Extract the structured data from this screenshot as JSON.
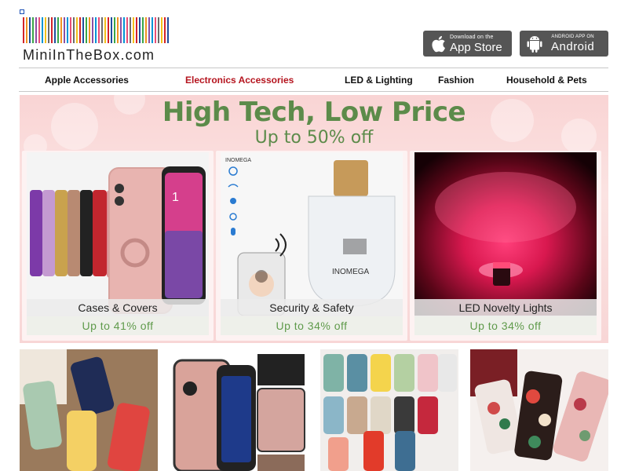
{
  "header": {
    "logo_text": "MiniInTheBox.com",
    "logo_bar_colors": [
      "#d2232a",
      "#f29322",
      "#1f4e9c",
      "#3aa648",
      "#8b4fa3",
      "#e94e77",
      "#0094d6",
      "#f3c11b",
      "#6b6b6b",
      "#d2232a",
      "#1f4e9c",
      "#3aa648",
      "#f29322",
      "#8b4fa3",
      "#0094d6",
      "#e94e77",
      "#6b6b6b",
      "#f3c11b",
      "#d2232a",
      "#1f4e9c",
      "#3aa648",
      "#f29322",
      "#8b4fa3",
      "#0094d6",
      "#e94e77",
      "#6b6b6b",
      "#f3c11b",
      "#d2232a",
      "#1f4e9c",
      "#3aa648",
      "#f29322",
      "#8b4fa3",
      "#0094d6",
      "#e94e77",
      "#6b6b6b",
      "#f3c11b",
      "#d2232a",
      "#1f4e9c",
      "#3aa648",
      "#f29322",
      "#8b4fa3",
      "#0094d6",
      "#e94e77",
      "#6b6b6b",
      "#f3c11b",
      "#d2232a",
      "#1f4e9c"
    ],
    "app_store": {
      "small": "Download on the",
      "big": "App Store",
      "icon": "apple-icon"
    },
    "android": {
      "small": "ANDROID APP ON",
      "big": "Android",
      "icon": "android-icon"
    }
  },
  "nav": {
    "items": [
      {
        "label": "Apple Accessories",
        "active": false
      },
      {
        "label": "Electronics Accessories",
        "active": true
      },
      {
        "label": "LED & Lighting",
        "active": false
      },
      {
        "label": "Fashion",
        "active": false
      },
      {
        "label": "Household & Pets",
        "active": false
      }
    ],
    "active_color": "#b5141e"
  },
  "banner": {
    "title": "High Tech, Low Price",
    "subtitle": "Up to 50% off",
    "accent_color": "#5c8b4a",
    "cards": [
      {
        "label": "Cases & Covers",
        "discount": "Up to 41% off"
      },
      {
        "label": "Security & Safety",
        "discount": "Up to 34% off"
      },
      {
        "label": "LED Novelty Lights",
        "discount": "Up to 34% off"
      }
    ]
  },
  "products": [
    {
      "image": "colorful-phone-cases-photo"
    },
    {
      "image": "rugged-pink-phone-case-photo"
    },
    {
      "image": "silicone-phone-case-grid-photo"
    },
    {
      "image": "floral-phone-cases-photo"
    }
  ]
}
